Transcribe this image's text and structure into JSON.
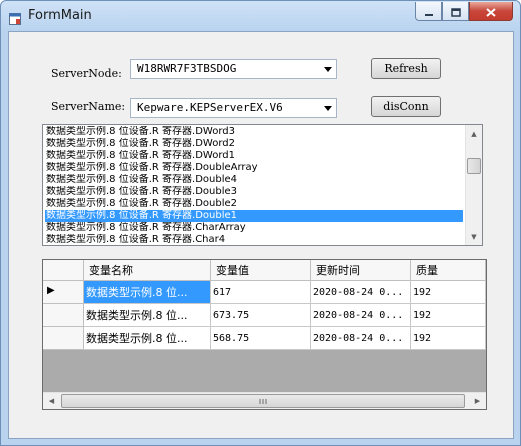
{
  "window": {
    "title": "FormMain"
  },
  "server_node": {
    "label": "ServerNode:",
    "value": "W18RWR7F3TBSDOG"
  },
  "server_name": {
    "label": "ServerName:",
    "value": "Kepware.KEPServerEX.V6"
  },
  "buttons": {
    "refresh": "Refresh",
    "disconn": "disConn"
  },
  "list": {
    "items": [
      "数据类型示例.8 位设备.R 寄存器.DWord3",
      "数据类型示例.8 位设备.R 寄存器.DWord2",
      "数据类型示例.8 位设备.R 寄存器.DWord1",
      "数据类型示例.8 位设备.R 寄存器.DoubleArray",
      "数据类型示例.8 位设备.R 寄存器.Double4",
      "数据类型示例.8 位设备.R 寄存器.Double3",
      "数据类型示例.8 位设备.R 寄存器.Double2",
      "数据类型示例.8 位设备.R 寄存器.Double1",
      "数据类型示例.8 位设备.R 寄存器.CharArray",
      "数据类型示例.8 位设备.R 寄存器.Char4"
    ],
    "selected_index": 7
  },
  "grid": {
    "columns": [
      "变量名称",
      "变量值",
      "更新时间",
      "质量"
    ],
    "rows": [
      [
        "数据类型示例.8 位...",
        "617",
        "2020-08-24 0...",
        "192"
      ],
      [
        "数据类型示例.8 位...",
        "673.75",
        "2020-08-24 0...",
        "192"
      ],
      [
        "数据类型示例.8 位...",
        "568.75",
        "2020-08-24 0...",
        "192"
      ]
    ],
    "current_row_marker": "▶"
  },
  "icons": {
    "app": "window-app-icon",
    "minimize": "minimize-icon",
    "maximize": "maximize-icon",
    "close": "close-icon"
  }
}
